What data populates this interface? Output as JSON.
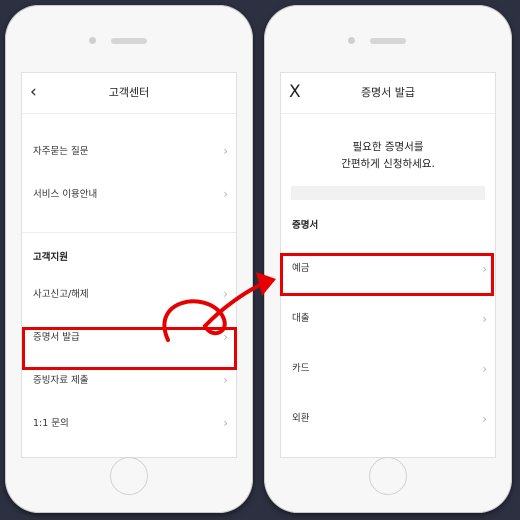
{
  "left": {
    "title": "고객센터",
    "back_icon": "‹",
    "items_top": [
      "자주묻는 질문",
      "서비스 이용안내"
    ],
    "section": "고객지원",
    "items_support": [
      "사고신고/해제",
      "증명서 발급",
      "증빙자료 제출",
      "1:1 문의"
    ]
  },
  "right": {
    "title": "증명서 발급",
    "close_icon": "X",
    "intro_line1": "필요한 증명서를",
    "intro_line2": "간편하게 신청하세요.",
    "section": "증명서",
    "items": [
      "예금",
      "대출",
      "카드",
      "외환"
    ]
  },
  "chevron": "›",
  "colors": {
    "highlight": "#e60000",
    "background": "#2d3040"
  }
}
